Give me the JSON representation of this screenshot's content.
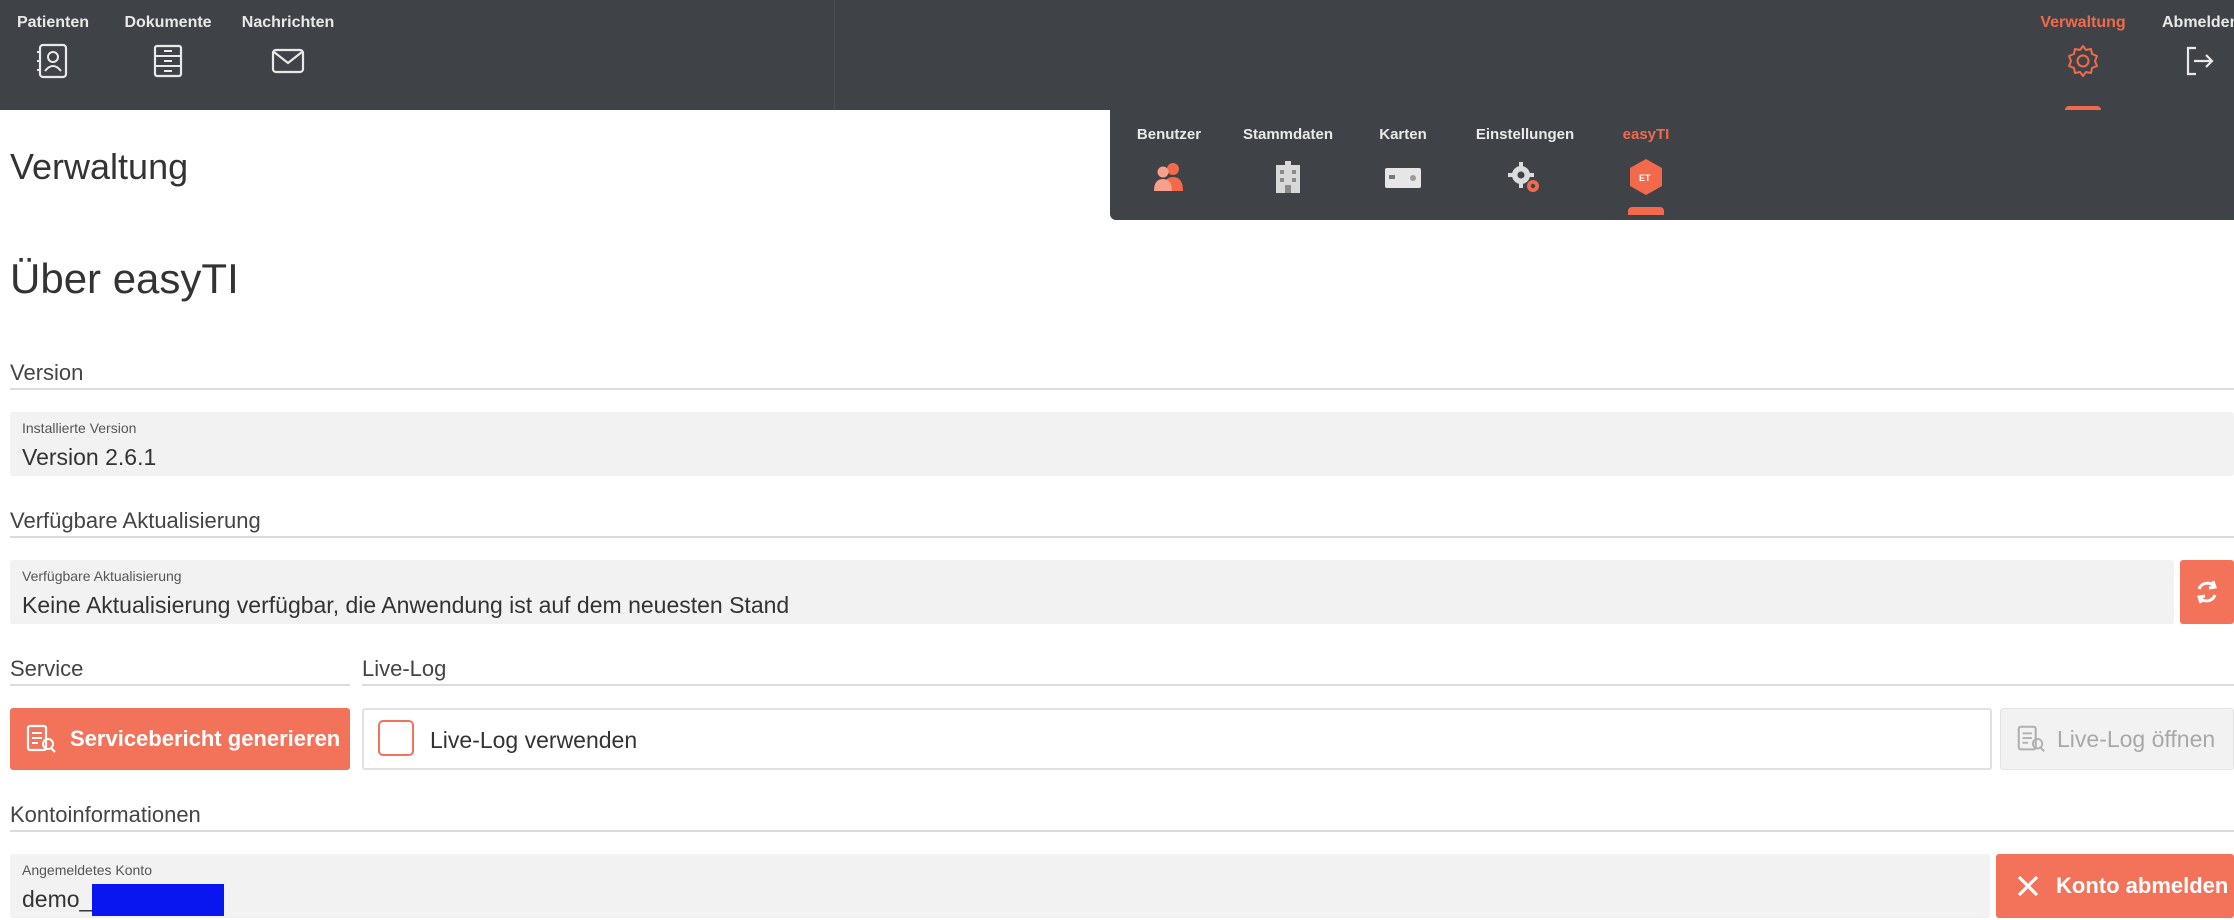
{
  "topnav": {
    "left": [
      {
        "label": "Patienten",
        "icon": "contact-card-icon"
      },
      {
        "label": "Dokumente",
        "icon": "file-cabinet-icon"
      },
      {
        "label": "Nachrichten",
        "icon": "envelope-icon"
      }
    ],
    "right": [
      {
        "label": "Verwaltung",
        "icon": "gear-icon",
        "active": true
      },
      {
        "label": "Abmelden",
        "icon": "logout-icon"
      }
    ]
  },
  "subnav": [
    {
      "label": "Benutzer",
      "icon": "users-icon"
    },
    {
      "label": "Stammdaten",
      "icon": "building-icon"
    },
    {
      "label": "Karten",
      "icon": "card-icon"
    },
    {
      "label": "Einstellungen",
      "icon": "gears-icon"
    },
    {
      "label": "easyTI",
      "icon": "easyti-hexagon-icon",
      "active": true
    }
  ],
  "page_title": "Verwaltung",
  "section_title": "Über easyTI",
  "version": {
    "group_label": "Version",
    "field_label": "Installierte Version",
    "value": "Version 2.6.1"
  },
  "update": {
    "group_label": "Verfügbare Aktualisierung",
    "field_label": "Verfügbare Aktualisierung",
    "value": "Keine Aktualisierung verfügbar, die Anwendung ist auf dem neuesten Stand"
  },
  "service": {
    "group_label": "Service",
    "button_label": "Servicebericht generieren"
  },
  "livelog": {
    "group_label": "Live-Log",
    "checkbox_label": "Live-Log verwenden",
    "open_button_label": "Live-Log öffnen"
  },
  "account": {
    "group_label": "Kontoinformationen",
    "field_label": "Angemeldetes Konto",
    "value": "demo_",
    "logout_button_label": "Konto abmelden"
  },
  "colors": {
    "accent": "#f26a4b",
    "topbar": "#3f4347",
    "redaction": "#0a16f0"
  }
}
